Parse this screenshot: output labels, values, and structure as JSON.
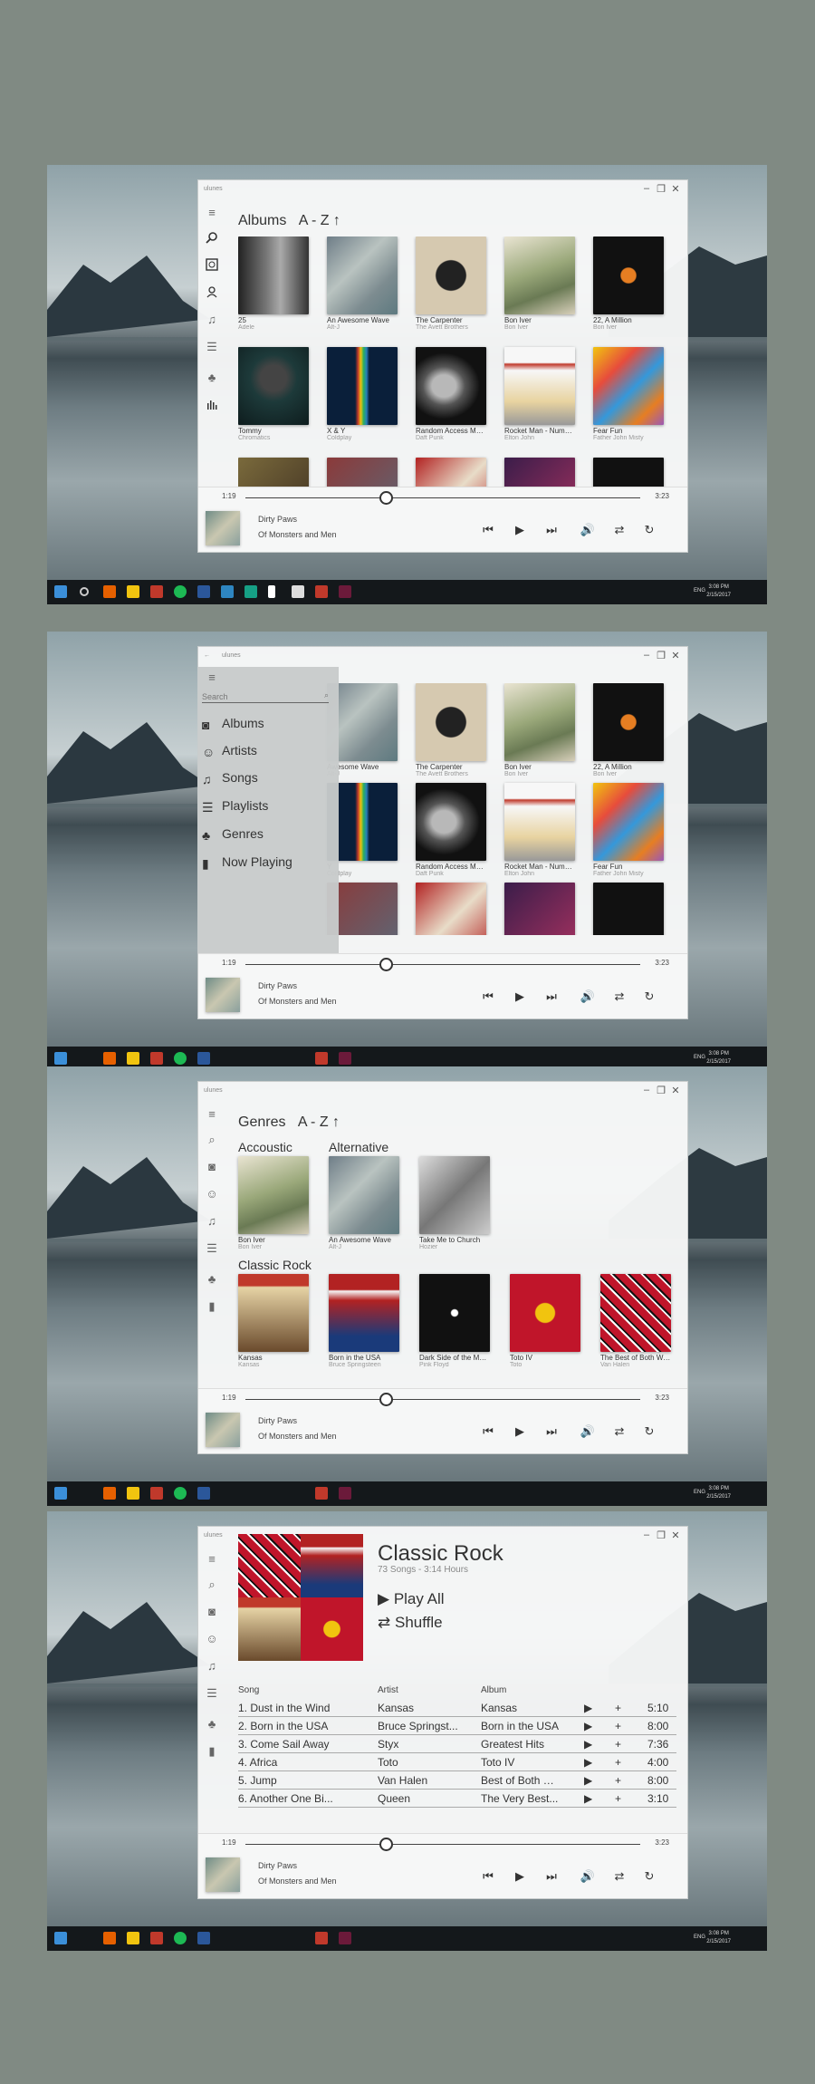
{
  "app_title": "ulunes",
  "player": {
    "elapsed": "1:19",
    "duration": "3:23",
    "progress": 0.37,
    "song": "Dirty Paws",
    "album": "Of Monsters and Men"
  },
  "taskbar": {
    "lang": "ENG",
    "time": "3:08 PM",
    "date": "2/15/2017"
  },
  "screen1": {
    "heading": "Albums",
    "sort": "A - Z",
    "albums": [
      {
        "title": "25",
        "artist": "Adele"
      },
      {
        "title": "An Awesome Wave",
        "artist": "Alt-J"
      },
      {
        "title": "The Carpenter",
        "artist": "The Avett Brothers"
      },
      {
        "title": "Bon Iver",
        "artist": "Bon Iver"
      },
      {
        "title": "22, A Million",
        "artist": "Bon Iver"
      },
      {
        "title": "Tommy",
        "artist": "Chromatics"
      },
      {
        "title": "X & Y",
        "artist": "Coldplay"
      },
      {
        "title": "Random Access Mem...",
        "artist": "Daft Punk"
      },
      {
        "title": "Rocket Man - Numbe...",
        "artist": "Elton John"
      },
      {
        "title": "Fear Fun",
        "artist": "Father John Misty"
      },
      {
        "title": "",
        "artist": ""
      },
      {
        "title": "",
        "artist": ""
      },
      {
        "title": "",
        "artist": ""
      },
      {
        "title": "",
        "artist": ""
      },
      {
        "title": "",
        "artist": ""
      }
    ]
  },
  "screen2": {
    "search_placeholder": "Search",
    "menu": [
      "Albums",
      "Artists",
      "Songs",
      "Playlists",
      "Genres",
      "Now Playing"
    ],
    "visible_tiles": [
      {
        "title": "Awesome Wave",
        "artist": "Alt-J"
      },
      {
        "title": "The Carpenter",
        "artist": "The Avett Brothers"
      },
      {
        "title": "Bon Iver",
        "artist": "Bon Iver"
      },
      {
        "title": "22, A Million",
        "artist": "Bon Iver"
      },
      {
        "title": "Y",
        "artist": "Coldplay"
      },
      {
        "title": "Random Access Mem...",
        "artist": "Daft Punk"
      },
      {
        "title": "Rocket Man - Numbe...",
        "artist": "Elton John"
      },
      {
        "title": "Fear Fun",
        "artist": "Father John Misty"
      }
    ]
  },
  "screen3": {
    "heading": "Genres",
    "sort": "A - Z",
    "genres": [
      {
        "name": "Accoustic",
        "albums": [
          {
            "title": "Bon Iver",
            "artist": "Bon Iver"
          }
        ]
      },
      {
        "name": "Alternative",
        "albums": [
          {
            "title": "An Awesome Wave",
            "artist": "Alt-J"
          },
          {
            "title": "Take Me to Church",
            "artist": "Hozier"
          }
        ]
      },
      {
        "name": "Classic Rock",
        "albums": [
          {
            "title": "Kansas",
            "artist": "Kansas"
          },
          {
            "title": "Born in the USA",
            "artist": "Bruce Springsteen"
          },
          {
            "title": "Dark Side of the Moo...",
            "artist": "Pink Floyd"
          },
          {
            "title": "Toto IV",
            "artist": "Toto"
          },
          {
            "title": "The Best of Both Wor...",
            "artist": "Van Halen"
          }
        ]
      }
    ]
  },
  "screen4": {
    "title": "Classic Rock",
    "subtitle": "73 Songs - 3:14 Hours",
    "play_all": "Play All",
    "shuffle": "Shuffle",
    "columns": {
      "song": "Song",
      "artist": "Artist",
      "album": "Album"
    },
    "rows": [
      {
        "song": "1. Dust in the Wind",
        "artist": "Kansas",
        "album": "Kansas",
        "time": "5:10"
      },
      {
        "song": "2. Born in the USA",
        "artist": "Bruce Springst...",
        "album": "Born in the USA",
        "time": "8:00"
      },
      {
        "song": "3. Come Sail Away",
        "artist": "Styx",
        "album": "Greatest Hits",
        "time": "7:36"
      },
      {
        "song": "4. Africa",
        "artist": "Toto",
        "album": "Toto IV",
        "time": "4:00"
      },
      {
        "song": "5. Jump",
        "artist": "Van Halen",
        "album": "Best of Both W...",
        "time": "8:00"
      },
      {
        "song": "6. Another One Bi...",
        "artist": "Queen",
        "album": "The Very Best...",
        "time": "3:10"
      }
    ]
  }
}
